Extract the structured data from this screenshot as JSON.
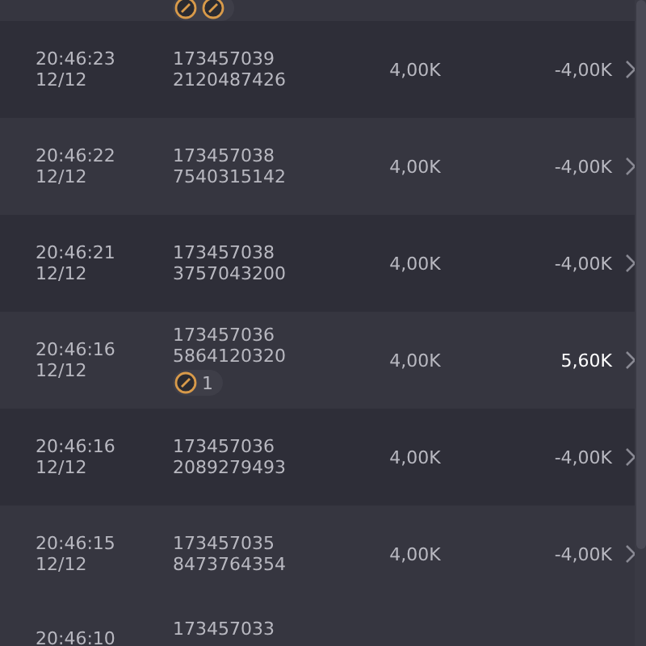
{
  "top_row": {
    "badge_icons": [
      {
        "kind": "coin"
      },
      {
        "kind": "coin"
      }
    ]
  },
  "rows": [
    {
      "time": "20:46:23",
      "date": "12/12",
      "id_1": "173457039",
      "id_2": "2120487426",
      "amount": "4,00K",
      "result": "-4,00K",
      "win": false
    },
    {
      "time": "20:46:22",
      "date": "12/12",
      "id_1": "173457038",
      "id_2": "7540315142",
      "amount": "4,00K",
      "result": "-4,00K",
      "win": false
    },
    {
      "time": "20:46:21",
      "date": "12/12",
      "id_1": "173457038",
      "id_2": "3757043200",
      "amount": "4,00K",
      "result": "-4,00K",
      "win": false
    },
    {
      "time": "20:46:16",
      "date": "12/12",
      "id_1": "173457036",
      "id_2": "5864120320",
      "amount": "4,00K",
      "result": "5,60K",
      "win": true,
      "badge": "1"
    },
    {
      "time": "20:46:16",
      "date": "12/12",
      "id_1": "173457036",
      "id_2": "2089279493",
      "amount": "4,00K",
      "result": "-4,00K",
      "win": false
    },
    {
      "time": "20:46:15",
      "date": "12/12",
      "id_1": "173457035",
      "id_2": "8473764354",
      "amount": "4,00K",
      "result": "-4,00K",
      "win": false
    }
  ],
  "partial_row": {
    "time": "20:46:10",
    "id_1": "173457033"
  }
}
